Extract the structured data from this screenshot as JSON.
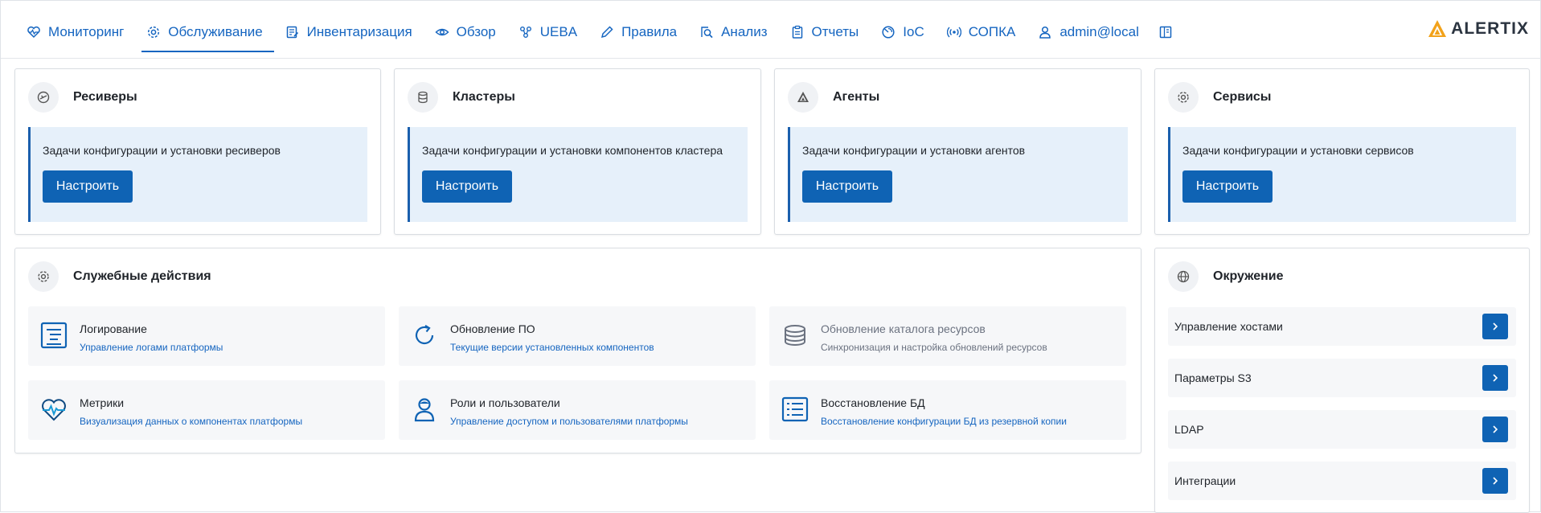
{
  "nav": {
    "items": [
      {
        "label": "Мониторинг",
        "icon": "heart-pulse-icon"
      },
      {
        "label": "Обслуживание",
        "icon": "gear-icon",
        "active": true
      },
      {
        "label": "Инвентаризация",
        "icon": "edit-list-icon"
      },
      {
        "label": "Обзор",
        "icon": "eye-icon"
      },
      {
        "label": "UEBA",
        "icon": "users-network-icon"
      },
      {
        "label": "Правила",
        "icon": "pencil-icon"
      },
      {
        "label": "Анализ",
        "icon": "search-doc-icon"
      },
      {
        "label": "Отчеты",
        "icon": "clipboard-icon"
      },
      {
        "label": "IoC",
        "icon": "radar-icon"
      },
      {
        "label": "СОПКА",
        "icon": "broadcast-icon"
      },
      {
        "label": "admin@local",
        "icon": "user-icon"
      }
    ],
    "docs_icon": "book-icon",
    "logo_text": "ALERTIX",
    "accent": "#1565c0"
  },
  "cards": [
    {
      "title": "Ресиверы",
      "icon": "receiver-icon",
      "desc": "Задачи конфигурации и установки ресиверов",
      "button": "Настроить"
    },
    {
      "title": "Кластеры",
      "icon": "database-icon",
      "desc": "Задачи конфигурации и установки компонентов кластера",
      "button": "Настроить"
    },
    {
      "title": "Агенты",
      "icon": "agent-icon",
      "desc": "Задачи конфигурации и установки агентов",
      "button": "Настроить"
    },
    {
      "title": "Сервисы",
      "icon": "gear-icon",
      "desc": "Задачи конфигурации и установки сервисов",
      "button": "Настроить"
    }
  ],
  "service": {
    "title": "Служебные действия",
    "icon": "gear-icon",
    "items": [
      {
        "title": "Логирование",
        "sub": "Управление логами платформы",
        "icon": "log-icon"
      },
      {
        "title": "Обновление ПО",
        "sub": "Текущие версии установленных компонентов",
        "icon": "refresh-icon"
      },
      {
        "title": "Обновление каталога ресурсов",
        "sub": "Синхронизация и настройка обновлений ресурсов",
        "icon": "database-icon"
      },
      {
        "title": "Метрики",
        "sub": "Визуализация данных о компонентах платформы",
        "icon": "heart-pulse-icon"
      },
      {
        "title": "Роли и пользователи",
        "sub": "Управление доступом и пользователями платформы",
        "icon": "user-icon"
      },
      {
        "title": "Восстановление БД",
        "sub": "Восстановление конфигурации БД из резервной копии",
        "icon": "list-icon"
      }
    ]
  },
  "environment": {
    "title": "Окружение",
    "icon": "globe-icon",
    "items": [
      {
        "label": "Управление хостами"
      },
      {
        "label": "Параметры S3"
      },
      {
        "label": "LDAP"
      },
      {
        "label": "Интеграции"
      }
    ]
  },
  "colors": {
    "primary": "#0f63b4",
    "info_bg": "#e6f0fa",
    "link": "#1565c0"
  }
}
